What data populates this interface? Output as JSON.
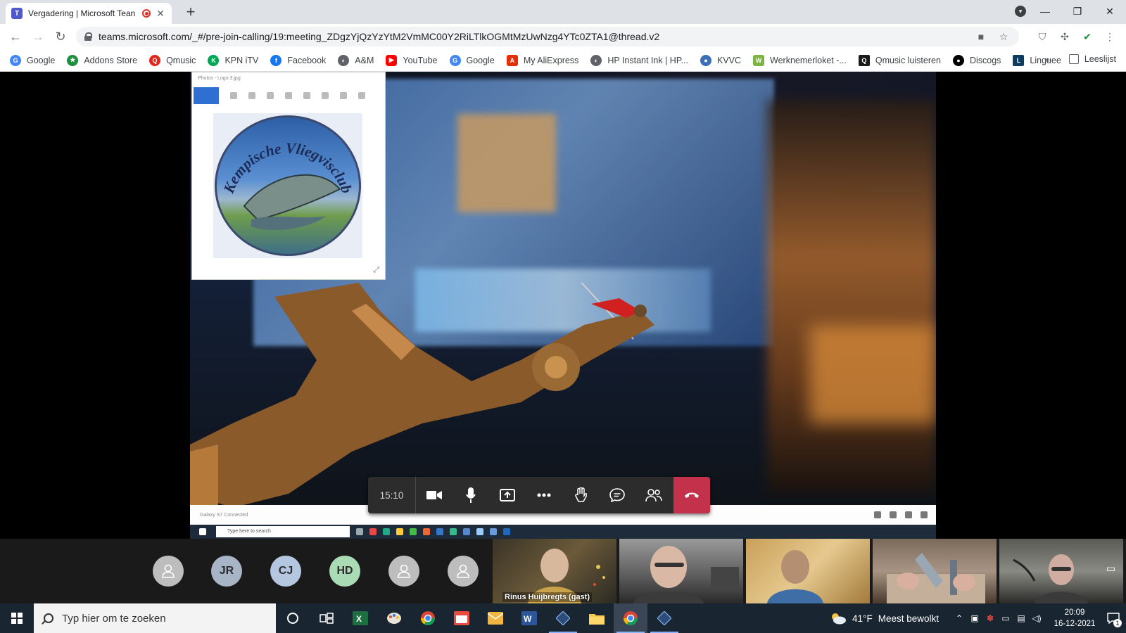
{
  "browser": {
    "tab": {
      "title": "Vergadering | Microsoft Tean",
      "favicon": "teams-icon",
      "recording": true
    },
    "window_controls": [
      "minimize-icon",
      "restore-icon",
      "close-icon"
    ],
    "url": "teams.microsoft.com/_#/pre-join-calling/19:meeting_ZDgzYjQzYzYtM2VmMC00Y2RiLTlkOGMtMzUwNzg4YTc0ZTA1@thread.v2",
    "bookmarks": [
      {
        "label": "Google",
        "icon": "google-icon",
        "color": "#4285f4"
      },
      {
        "label": "Addons Store",
        "icon": "addons-icon",
        "color": "#1e8e3e"
      },
      {
        "label": "Qmusic",
        "icon": "qmusic-icon",
        "color": "#e1261c"
      },
      {
        "label": "KPN iTV",
        "icon": "kpn-icon",
        "color": "#00a651"
      },
      {
        "label": "Facebook",
        "icon": "facebook-icon",
        "color": "#1877f2"
      },
      {
        "label": "A&M",
        "icon": "am-icon",
        "color": "#5f6368"
      },
      {
        "label": "YouTube",
        "icon": "youtube-icon",
        "color": "#ff0000"
      },
      {
        "label": "Google",
        "icon": "google-icon",
        "color": "#4285f4"
      },
      {
        "label": "My AliExpress",
        "icon": "aliexpress-icon",
        "color": "#e62e04"
      },
      {
        "label": "HP Instant Ink | HP...",
        "icon": "hp-icon",
        "color": "#5f6368"
      },
      {
        "label": "KVVC",
        "icon": "kvvc-icon",
        "color": "#3b6fb6"
      },
      {
        "label": "Werknemerloket -...",
        "icon": "werknemerloket-icon",
        "color": "#7cb342"
      },
      {
        "label": "Qmusic luisteren",
        "icon": "qmusic-luisteren-icon",
        "color": "#1a1a1a"
      },
      {
        "label": "Discogs",
        "icon": "discogs-icon",
        "color": "#000000"
      },
      {
        "label": "Linguee",
        "icon": "linguee-icon",
        "color": "#0f3b5f"
      }
    ],
    "more_bookmarks": "»",
    "reading_list": "Leeslijst"
  },
  "meeting": {
    "shared_window_title": "Photos - Logo 3.jpg",
    "logo_text": "Kempische Vliegvisclub",
    "shared_status": "Galaxy S7 Connected",
    "shared_search": "Type here to search",
    "timer": "15:10",
    "controls": [
      "camera-icon",
      "microphone-icon",
      "share-screen-icon",
      "more-options-icon",
      "raise-hand-icon",
      "chat-icon",
      "participants-icon"
    ],
    "hangup_color": "#c4314b"
  },
  "participants": {
    "avatars": [
      {
        "initials": "",
        "icon": "person-icon",
        "color": "#bdbdbd"
      },
      {
        "initials": "JR",
        "color": "#a8b5c7"
      },
      {
        "initials": "CJ",
        "color": "#b5c6e0"
      },
      {
        "initials": "HD",
        "color": "#a9dcb5"
      },
      {
        "initials": "",
        "icon": "person-icon",
        "color": "#bdbdbd"
      },
      {
        "initials": "",
        "icon": "person-icon",
        "color": "#bdbdbd"
      }
    ],
    "video_tiles": [
      {
        "name": "Rinus Huijbregts (gast)"
      },
      {
        "name": ""
      },
      {
        "name": ""
      },
      {
        "name": ""
      },
      {
        "name": ""
      }
    ]
  },
  "taskbar": {
    "search_placeholder": "Typ hier om te zoeken",
    "apps": [
      "cortana-icon",
      "task-view-icon",
      "excel-icon",
      "paint-icon",
      "chrome-icon",
      "calendar-icon",
      "mail-icon",
      "word-icon",
      "app-icon",
      "file-explorer-icon",
      "chrome-active-icon",
      "app2-icon"
    ],
    "weather_temp": "41°F",
    "weather_text": "Meest bewolkt",
    "time": "20:09",
    "date": "16-12-2021",
    "notifications": "1"
  }
}
